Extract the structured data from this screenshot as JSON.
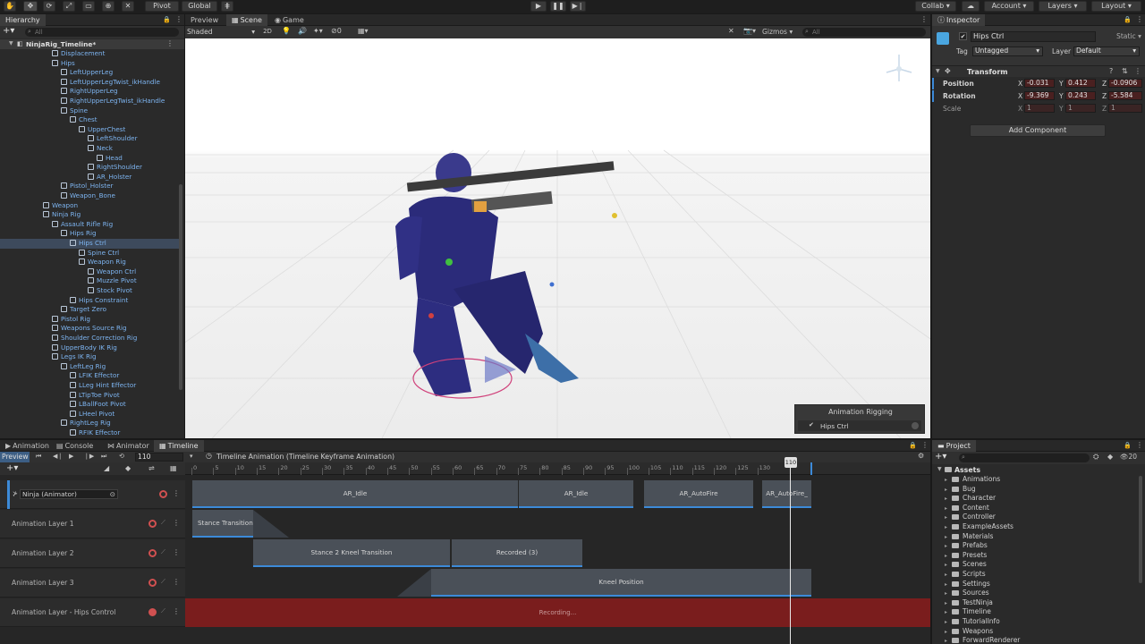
{
  "toolbar": {
    "pivot": "Pivot",
    "global": "Global",
    "collab": "Collab",
    "account": "Account",
    "layers": "Layers",
    "layout": "Layout"
  },
  "hierarchy": {
    "tab": "Hierarchy",
    "search_placeholder": "All",
    "root": "NinjaRig_Timeline*",
    "items": [
      {
        "label": "Displacement",
        "indent": 4
      },
      {
        "label": "Hips",
        "indent": 4
      },
      {
        "label": "LeftUpperLeg",
        "indent": 5
      },
      {
        "label": "LeftUpperLegTwist_ikHandle",
        "indent": 5
      },
      {
        "label": "RightUpperLeg",
        "indent": 5
      },
      {
        "label": "RightUpperLegTwist_ikHandle",
        "indent": 5
      },
      {
        "label": "Spine",
        "indent": 5
      },
      {
        "label": "Chest",
        "indent": 6
      },
      {
        "label": "UpperChest",
        "indent": 7
      },
      {
        "label": "LeftShoulder",
        "indent": 8
      },
      {
        "label": "Neck",
        "indent": 8
      },
      {
        "label": "Head",
        "indent": 9
      },
      {
        "label": "RightShoulder",
        "indent": 8
      },
      {
        "label": "AR_Holster",
        "indent": 8
      },
      {
        "label": "Pistol_Holster",
        "indent": 5
      },
      {
        "label": "Weapon_Bone",
        "indent": 5
      },
      {
        "label": "Weapon",
        "indent": 3
      },
      {
        "label": "Ninja Rig",
        "indent": 3
      },
      {
        "label": "Assault Rifle Rig",
        "indent": 4
      },
      {
        "label": "Hips Rig",
        "indent": 5
      },
      {
        "label": "Hips Ctrl",
        "indent": 6,
        "selected": true
      },
      {
        "label": "Spine Ctrl",
        "indent": 7
      },
      {
        "label": "Weapon Rig",
        "indent": 7
      },
      {
        "label": "Weapon Ctrl",
        "indent": 8
      },
      {
        "label": "Muzzle Pivot",
        "indent": 8
      },
      {
        "label": "Stock Pivot",
        "indent": 8
      },
      {
        "label": "Hips Constraint",
        "indent": 6
      },
      {
        "label": "Target Zero",
        "indent": 5
      },
      {
        "label": "Pistol Rig",
        "indent": 4
      },
      {
        "label": "Weapons Source Rig",
        "indent": 4
      },
      {
        "label": "Shoulder Correction Rig",
        "indent": 4
      },
      {
        "label": "UpperBody IK Rig",
        "indent": 4
      },
      {
        "label": "Legs IK Rig",
        "indent": 4
      },
      {
        "label": "LeftLeg Rig",
        "indent": 5
      },
      {
        "label": "LFIK Effector",
        "indent": 6
      },
      {
        "label": "LLeg Hint Effector",
        "indent": 6
      },
      {
        "label": "LTipToe Pivot",
        "indent": 6
      },
      {
        "label": "LBallFoot Pivot",
        "indent": 6
      },
      {
        "label": "LHeel Pivot",
        "indent": 6
      },
      {
        "label": "RightLeg Rig",
        "indent": 5
      },
      {
        "label": "RFIK Effector",
        "indent": 6
      }
    ]
  },
  "scene": {
    "tabs": [
      "Preview",
      "Scene",
      "Game"
    ],
    "shading": "Shaded",
    "mode2d": "2D",
    "gizmos": "Gizmos",
    "search": "All",
    "fx_count": "0",
    "overlay_title": "Animation Rigging",
    "overlay_item": "Hips Ctrl"
  },
  "inspector": {
    "tab": "Inspector",
    "object_name": "Hips Ctrl",
    "static": "Static",
    "tag_label": "Tag",
    "tag_value": "Untagged",
    "layer_label": "Layer",
    "layer_value": "Default",
    "component": "Transform",
    "position_label": "Position",
    "rotation_label": "Rotation",
    "scale_label": "Scale",
    "position": {
      "x": "-0.031",
      "y": "0.412",
      "z": "-0.0906"
    },
    "rotation": {
      "x": "-9.369",
      "y": "0.243",
      "z": "-5.584"
    },
    "scale": {
      "x": "1",
      "y": "1",
      "z": "1"
    },
    "add_component": "Add Component"
  },
  "bottom_tabs": [
    "Animation",
    "Console",
    "Animator",
    "Timeline"
  ],
  "timeline": {
    "preview": "Preview",
    "frame": "110",
    "asset_label": "Timeline Animation (Timeline Keyframe Animation)",
    "playhead_label": "110",
    "ruler": [
      "0",
      "5",
      "10",
      "15",
      "20",
      "25",
      "30",
      "35",
      "40",
      "45",
      "50",
      "55",
      "60",
      "65",
      "70",
      "75",
      "80",
      "85",
      "90",
      "95",
      "100",
      "105",
      "110",
      "115",
      "120",
      "125",
      "130"
    ],
    "tracks": [
      {
        "name": "Ninja (Animator)",
        "clips": [
          "AR_Idle",
          "AR_Idle",
          "AR_AutoFire",
          "AR_AutoFire_"
        ]
      },
      {
        "name": "Animation Layer 1",
        "clips": [
          "Stance Transition"
        ]
      },
      {
        "name": "Animation Layer 2",
        "clips": [
          "Stance 2 Kneel Transition",
          "Recorded (3)"
        ]
      },
      {
        "name": "Animation Layer 3",
        "clips": [
          "Kneel Position"
        ]
      },
      {
        "name": "Animation Layer - Hips Control",
        "clips": [
          "Recording..."
        ]
      }
    ]
  },
  "project": {
    "tab": "Project",
    "count": "20",
    "root": "Assets",
    "folders": [
      "Animations",
      "Bug",
      "Character",
      "Content",
      "Controller",
      "ExampleAssets",
      "Materials",
      "Prefabs",
      "Presets",
      "Scenes",
      "Scripts",
      "Settings",
      "Sources",
      "TestNinja",
      "Timeline",
      "TutorialInfo",
      "Weapons",
      "ForwardRenderer"
    ]
  },
  "colors": {
    "accent_blue": "#3c8ad8",
    "record_red": "#7a1d1d",
    "hierarchy_text": "#7db4f0"
  }
}
